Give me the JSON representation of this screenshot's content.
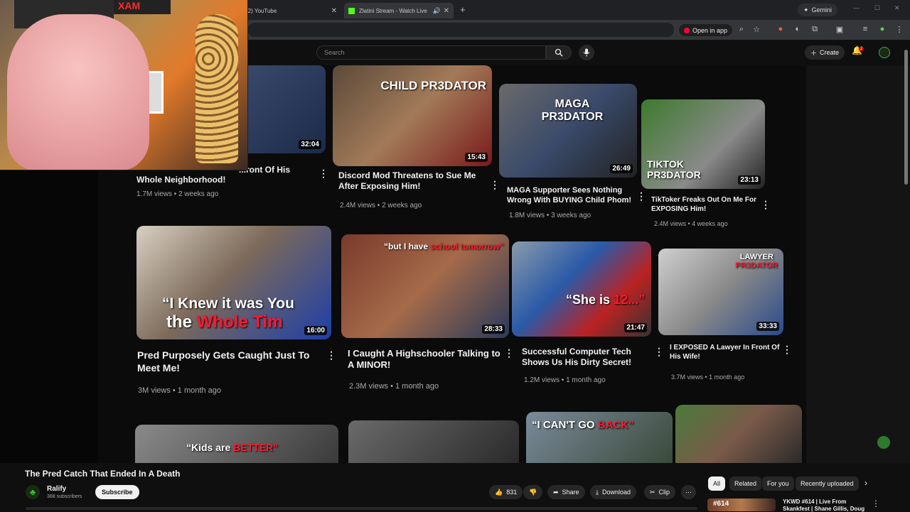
{
  "browser": {
    "tabs": [
      {
        "label": "(2) YouTube"
      },
      {
        "label": "Zlatini Stream - Watch Live"
      }
    ],
    "gemini_label": "Gemini",
    "open_in_app_label": "Open in app"
  },
  "yt_header": {
    "search_placeholder": "Search",
    "create_label": "Create",
    "notification_count": "2"
  },
  "videos_row1": [
    {
      "title_line1": "Whole Neighborhood!",
      "title_partial": "...ront Of His",
      "meta": "1.7M views • 2 weeks ago",
      "duration": "32:04"
    },
    {
      "title": "Discord Mod Threatens to Sue Me After Exposing Him!",
      "meta": "2.4M views • 2 weeks ago",
      "duration": "15:43",
      "overlay": "CHILD PR3DATOR"
    },
    {
      "title": "MAGA Supporter Sees Nothing Wrong With BUYING Child Phom!",
      "meta": "1.8M views • 3 weeks ago",
      "duration": "26:49",
      "overlay": "MAGA PR3DATOR"
    },
    {
      "title": "TikToker Freaks Out On Me For EXPOSING Him!",
      "meta": "2.4M views • 4 weeks ago",
      "duration": "23:13",
      "overlay": "TIKTOK PR3DATOR"
    }
  ],
  "videos_row2": [
    {
      "title": "Pred Purposely Gets Caught Just To Meet Me!",
      "meta": "3M views • 1 month ago",
      "duration": "16:00",
      "overlay_a": "“I Knew it was You",
      "overlay_b1": "the",
      "overlay_b2": "Whole Tim"
    },
    {
      "title": "I Caught A Highschooler Talking to A MINOR!",
      "meta": "2.3M views • 1 month ago",
      "duration": "28:33",
      "overlay_a": "“but I have",
      "overlay_b": "school tomorrow”"
    },
    {
      "title": "Successful Computer Tech Shows Us His Dirty Secret!",
      "meta": "1.2M views • 1 month ago",
      "duration": "21:47",
      "overlay_a": "“She is",
      "overlay_b": "12...”"
    },
    {
      "title": "I EXPOSED A Lawyer In Front Of His Wife!",
      "meta": "3.7M views • 1 month ago",
      "duration": "33:33",
      "overlay_a": "LAWYER",
      "overlay_b": "PR3DATOR"
    }
  ],
  "videos_row3": [
    {
      "overlay_a": "“Kids are",
      "overlay_b": "BETTER”"
    },
    {},
    {
      "overlay_a": "“I CAN'T GO",
      "overlay_b": "BACK”"
    },
    {}
  ],
  "player": {
    "video_title": "The Pred Catch That Ended In A Death",
    "channel_name": "Ralify",
    "channel_subs": "368 subscribers",
    "subscribe_label": "Subscribe",
    "like_count": "831",
    "share_label": "Share",
    "download_label": "Download",
    "clip_label": "Clip"
  },
  "chips": [
    "All",
    "Related",
    "For you",
    "Recently uploaded"
  ],
  "recommendation": {
    "thumb_text": "#614",
    "title": "YKWD #614 | Live From Skankfest | Shane Gillis, Doug"
  },
  "colors": {
    "accent_red": "#ff0033",
    "background": "#0f0f0f",
    "kick_green": "#53fc18"
  }
}
